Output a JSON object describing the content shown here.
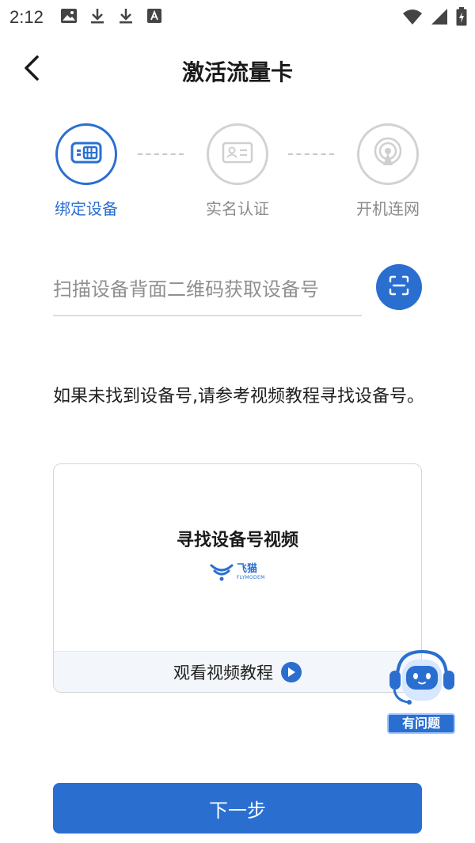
{
  "status_bar": {
    "time": "2:12",
    "left_icons": [
      "image-icon",
      "download-icon",
      "download-icon",
      "font-icon"
    ],
    "right_icons": [
      "wifi-icon",
      "cell-signal-icon",
      "battery-charging-icon"
    ]
  },
  "nav": {
    "title": "激活流量卡",
    "back_icon": "chevron-left-icon"
  },
  "steps": [
    {
      "label": "绑定设备",
      "icon": "sim-card-icon",
      "state": "active"
    },
    {
      "label": "实名认证",
      "icon": "id-card-icon",
      "state": "inactive"
    },
    {
      "label": "开机连网",
      "icon": "signal-tower-icon",
      "state": "inactive"
    }
  ],
  "device_input": {
    "placeholder": "扫描设备背面二维码获取设备号",
    "value": "",
    "scan_icon": "scan-icon"
  },
  "hint": "如果未找到设备号,请参考视频教程寻找设备号。",
  "video_card": {
    "title": "寻找设备号视频",
    "logo_cn": "飞猫",
    "logo_en": "FLYMODEM",
    "footer_label": "观看视频教程",
    "footer_icon": "play-icon"
  },
  "help_widget": {
    "label": "有问题",
    "icon": "robot-assistant-icon"
  },
  "next_button": {
    "label": "下一步"
  },
  "colors": {
    "accent": "#2a6fd0",
    "inactive": "#d2d2d2"
  }
}
